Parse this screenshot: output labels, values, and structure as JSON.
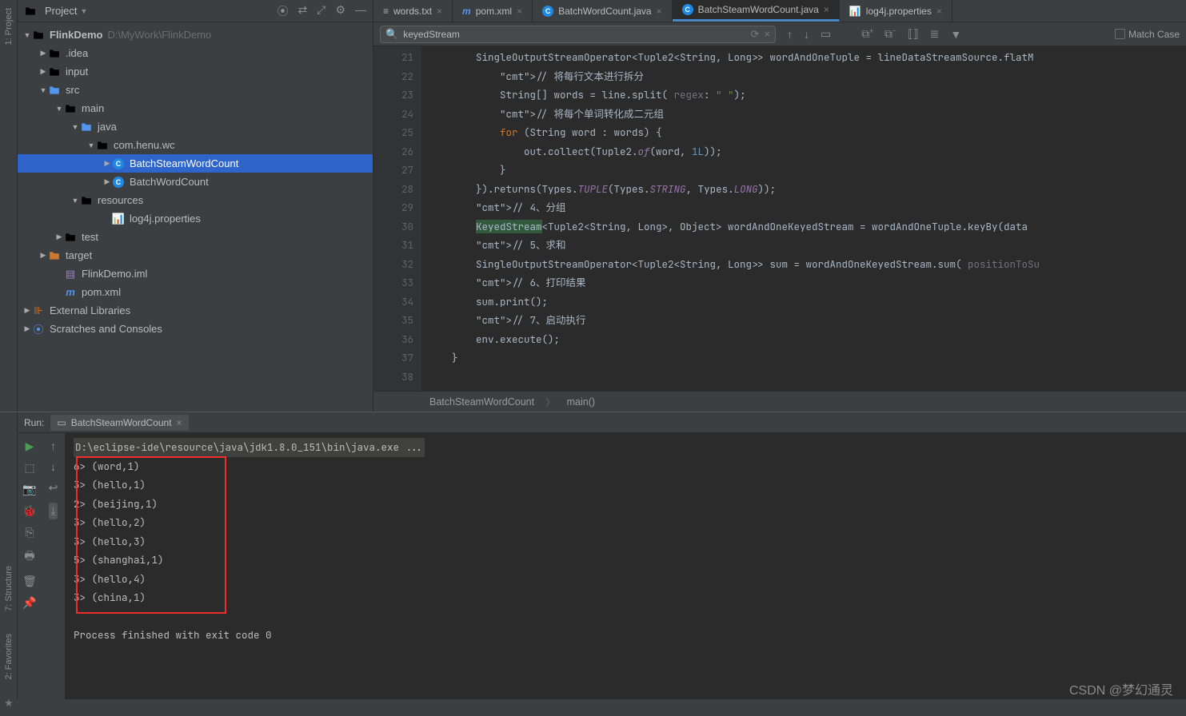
{
  "sidebar_tabs": {
    "project": "1: Project"
  },
  "project_panel": {
    "title": "Project",
    "root": {
      "name": "FlinkDemo",
      "path": "D:\\MyWork\\FlinkDemo"
    },
    "nodes": {
      "idea": ".idea",
      "input": "input",
      "src": "src",
      "main": "main",
      "java": "java",
      "pkg": "com.henu.wc",
      "cls1": "BatchSteamWordCount",
      "cls2": "BatchWordCount",
      "resources": "resources",
      "log4j": "log4j.properties",
      "test": "test",
      "target": "target",
      "iml": "FlinkDemo.iml",
      "pom": "pom.xml",
      "extlib": "External Libraries",
      "scratches": "Scratches and Consoles"
    }
  },
  "tabs": [
    {
      "label": "words.txt",
      "icon": "txt"
    },
    {
      "label": "pom.xml",
      "icon": "m"
    },
    {
      "label": "BatchWordCount.java",
      "icon": "c"
    },
    {
      "label": "BatchSteamWordCount.java",
      "icon": "c",
      "active": true
    },
    {
      "label": "log4j.properties",
      "icon": "p"
    }
  ],
  "find": {
    "value": "keyedStream",
    "match_case": "Match Case"
  },
  "code": {
    "line_start": 21,
    "lines": [
      "        SingleOutputStreamOperator<Tuple2<String, Long>> wordAndOneTuple = lineDataStreamSource.flatM",
      "            // 将每行文本进行拆分",
      "            String[] words = line.split( regex: \" \");",
      "            // 将每个单词转化成二元组",
      "            for (String word : words) {",
      "                out.collect(Tuple2.of(word, 1L));",
      "            }",
      "        }).returns(Types.TUPLE(Types.STRING, Types.LONG));",
      "        // 4、分组",
      "        KeyedStream<Tuple2<String, Long>, Object> wordAndOneKeyedStream = wordAndOneTuple.keyBy(data ",
      "        // 5、求和",
      "        SingleOutputStreamOperator<Tuple2<String, Long>> sum = wordAndOneKeyedStream.sum( positionToSu",
      "        // 6、打印结果",
      "        sum.print();",
      "        // 7、启动执行",
      "        env.execute();",
      "    }",
      ""
    ]
  },
  "breadcrumbs": {
    "a": "BatchSteamWordCount",
    "b": "main()"
  },
  "run": {
    "title": "Run:",
    "tab": "BatchSteamWordCount",
    "cmd": "D:\\eclipse-ide\\resource\\java\\jdk1.8.0_151\\bin\\java.exe ...",
    "lines": [
      "6> (word,1)",
      "3> (hello,1)",
      "2> (beijing,1)",
      "3> (hello,2)",
      "3> (hello,3)",
      "5> (shanghai,1)",
      "3> (hello,4)",
      "3> (china,1)"
    ],
    "exit": "Process finished with exit code 0"
  },
  "bottom_tabs": {
    "structure": "7: Structure",
    "favorites": "2: Favorites"
  },
  "watermark": "CSDN @梦幻通灵"
}
